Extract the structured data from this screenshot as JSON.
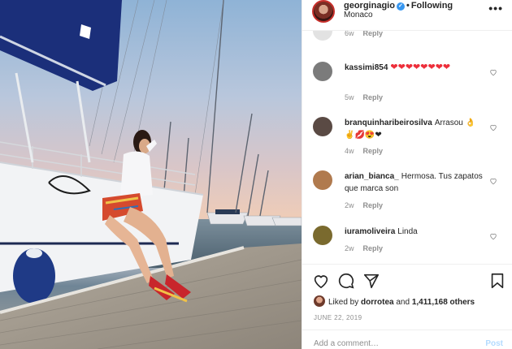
{
  "post": {
    "username": "georginagio",
    "follow_label": "Following",
    "location": "Monaco",
    "more_glyph": "•••"
  },
  "comments": [
    {
      "username": "",
      "text": "",
      "age": "6w",
      "reply_label": "Reply",
      "avatar_color": "#dcdcdc"
    },
    {
      "username": "kassimi854",
      "text": "❤❤❤❤❤❤❤❤",
      "age": "5w",
      "reply_label": "Reply",
      "avatar_color": "#7b7b7b"
    },
    {
      "username": "branquinharibeirosilva",
      "text": "Arrasou 👌✌💋😍❤",
      "age": "4w",
      "reply_label": "Reply",
      "avatar_color": "#5a4a44"
    },
    {
      "username": "arian_bianca_",
      "text": "Hermosa. Tus zapatos que marca son",
      "age": "2w",
      "reply_label": "Reply",
      "avatar_color": "#b07a4e"
    },
    {
      "username": "iuramoliveira",
      "text": "Linda",
      "age": "2w",
      "reply_label": "Reply",
      "avatar_color": "#7a6a2e"
    }
  ],
  "actions": {
    "liked_by_prefix": "Liked by",
    "liked_by_user": "dorrotea",
    "and_label": "and",
    "others_count": "1,411,168 others",
    "date": "JUNE 22, 2019",
    "add_comment_placeholder": "Add a comment…",
    "post_label": "Post"
  },
  "colors": {
    "accent_blue": "#3897f0",
    "heart_red": "#ed2e3a",
    "muted_text": "#8e8e8e"
  },
  "icons": [
    "heart-icon",
    "comment-icon",
    "share-icon",
    "bookmark-icon",
    "verified-badge-icon",
    "more-options-icon"
  ]
}
